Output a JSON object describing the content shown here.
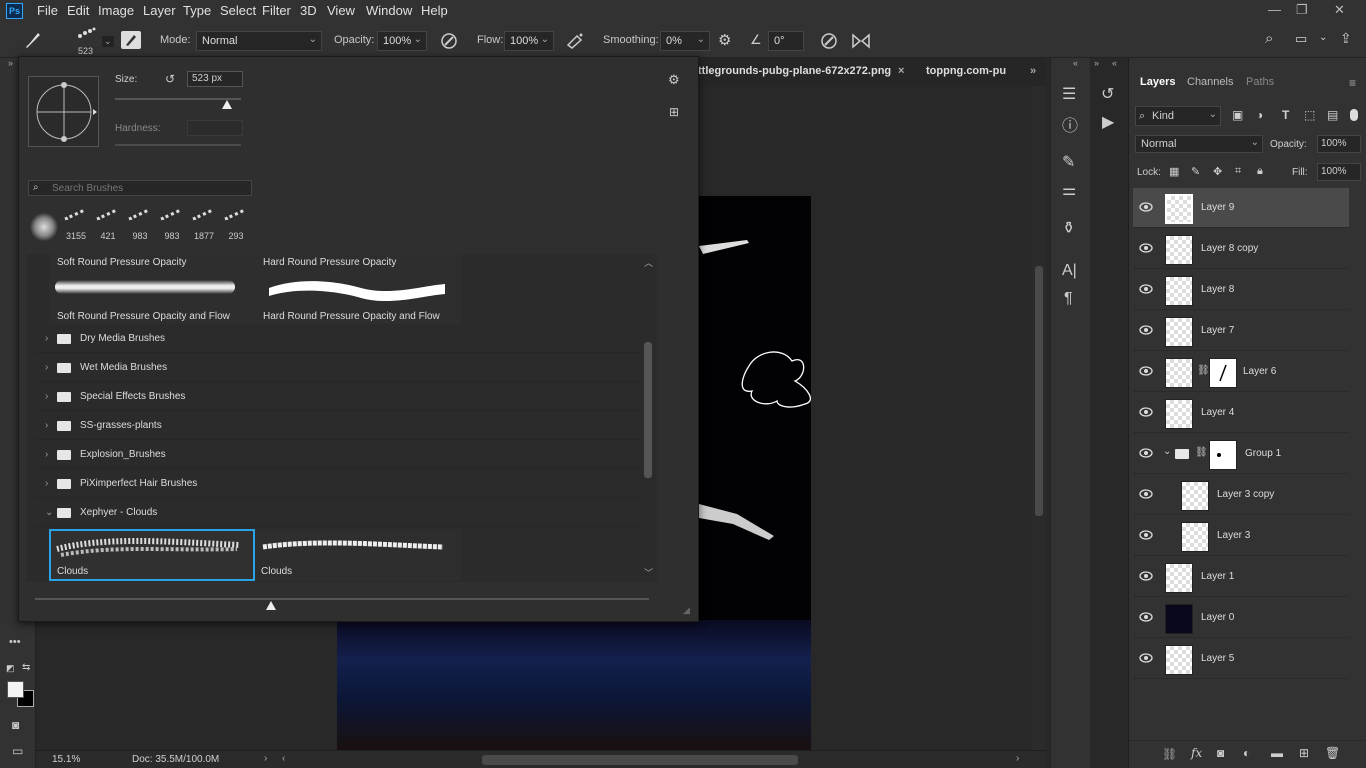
{
  "app": {
    "logo": "Ps"
  },
  "menu": [
    "File",
    "Edit",
    "Image",
    "Layer",
    "Type",
    "Select",
    "Filter",
    "3D",
    "View",
    "Window",
    "Help"
  ],
  "options": {
    "brush_size": "523",
    "mode_label": "Mode:",
    "mode_value": "Normal",
    "opacity_label": "Opacity:",
    "opacity_value": "100%",
    "flow_label": "Flow:",
    "flow_value": "100%",
    "smoothing_label": "Smoothing:",
    "smoothing_value": "0%",
    "angle_value": "0°"
  },
  "doc_tabs": [
    "ttlegrounds-pubg-plane-672x272.png",
    "toppng.com-pu"
  ],
  "brush_panel": {
    "size_label": "Size:",
    "size_value": "523 px",
    "hardness_label": "Hardness:",
    "search_placeholder": "Search Brushes",
    "preset_counts": [
      "3155",
      "421",
      "983",
      "983",
      "1877",
      "293"
    ],
    "brushes_row": [
      {
        "top": "Soft Round Pressure Opacity",
        "bottom": "Soft Round Pressure Opacity and Flow"
      },
      {
        "top": "Hard Round Pressure Opacity",
        "bottom": "Hard Round Pressure Opacity and Flow"
      }
    ],
    "folders": [
      "Dry Media Brushes",
      "Wet Media Brushes",
      "Special Effects Brushes",
      "SS-grasses-plants",
      "Explosion_Brushes",
      "PiXimperfect Hair Brushes",
      "Xephyer - Clouds"
    ],
    "cloud_brushes": [
      "Clouds",
      "Clouds"
    ]
  },
  "status": {
    "zoom": "15.1%",
    "doc": "Doc: 35.5M/100.0M"
  },
  "layers_panel": {
    "tabs": [
      "Layers",
      "Channels",
      "Paths"
    ],
    "filter_kind": "Kind",
    "blend_mode": "Normal",
    "opacity_label": "Opacity:",
    "opacity_value": "100%",
    "lock_label": "Lock:",
    "fill_label": "Fill:",
    "fill_value": "100%",
    "layers": [
      {
        "name": "Layer 9"
      },
      {
        "name": "Layer 8 copy"
      },
      {
        "name": "Layer 8"
      },
      {
        "name": "Layer 7"
      },
      {
        "name": "Layer 6"
      },
      {
        "name": "Layer 4"
      },
      {
        "name": "Group 1"
      },
      {
        "name": "Layer 3 copy"
      },
      {
        "name": "Layer 3"
      },
      {
        "name": "Layer 1"
      },
      {
        "name": "Layer 0"
      },
      {
        "name": "Layer 5"
      }
    ]
  },
  "colors": {
    "accent": "#31a8ff",
    "selected_border": "#2aa4e6"
  }
}
